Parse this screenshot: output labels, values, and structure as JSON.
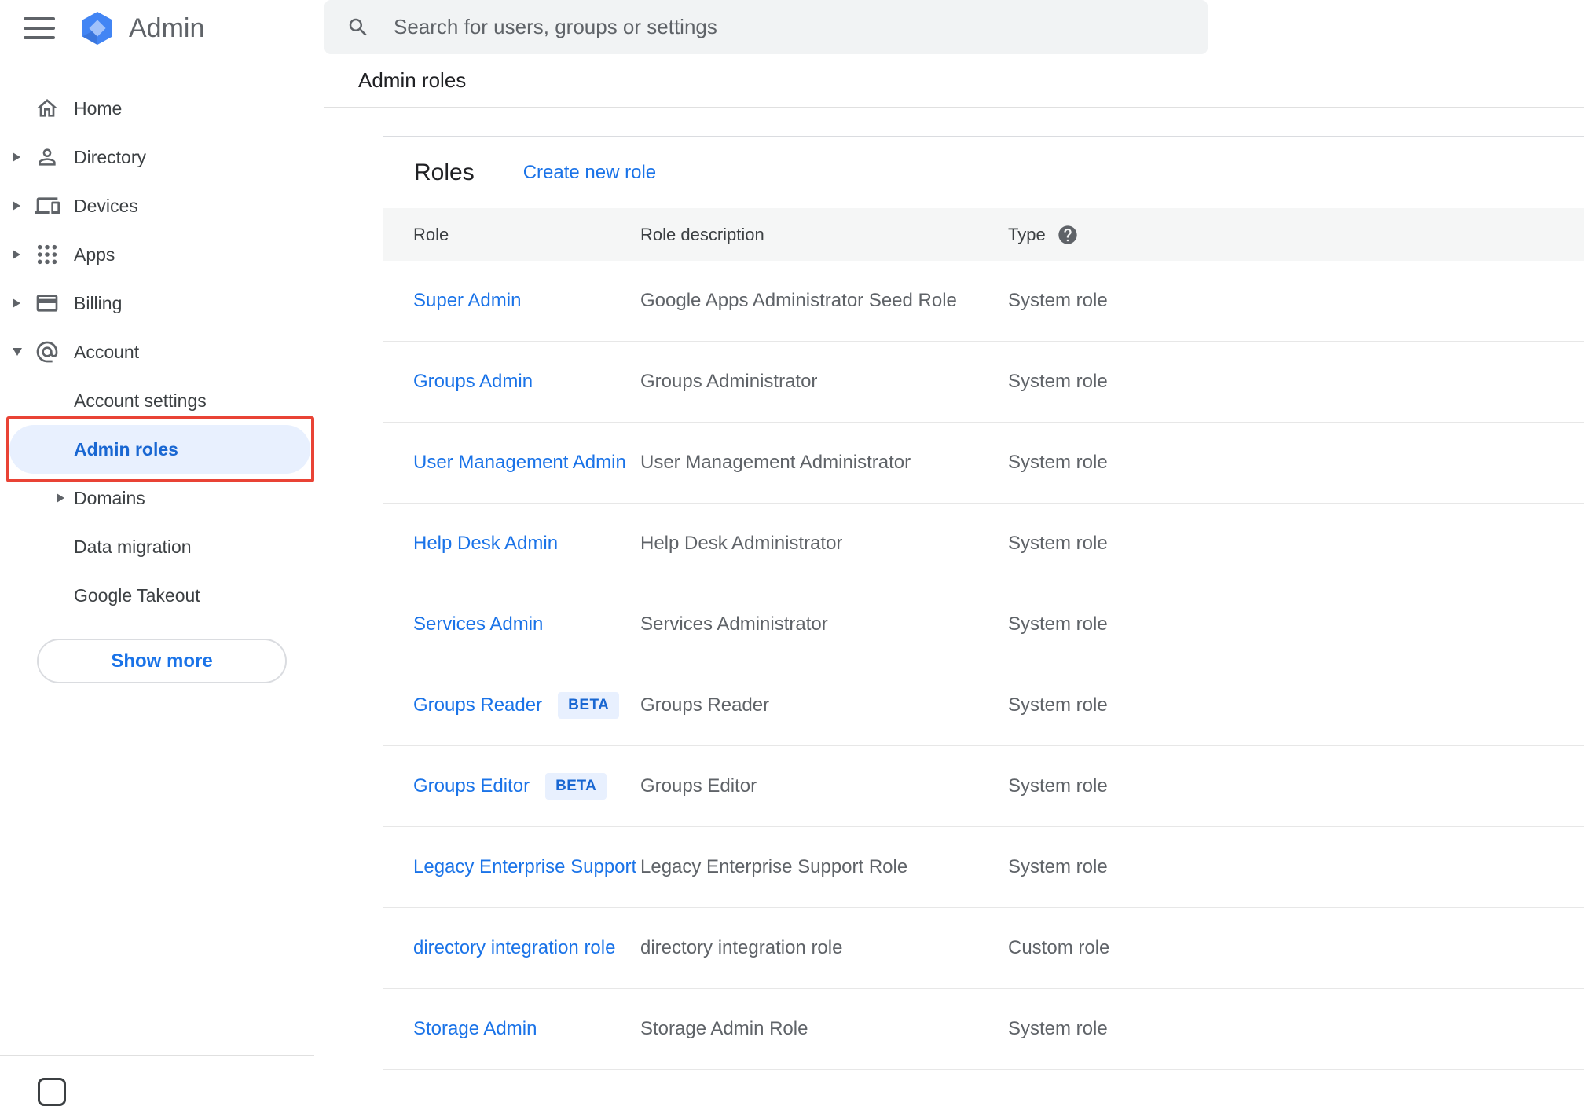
{
  "app": {
    "product_name": "Admin"
  },
  "icons": {
    "menu": "hamburger-menu-icon",
    "logo": "admin-hexagon-logo-icon",
    "search": "search-icon",
    "type_help": "help-circle-icon"
  },
  "search": {
    "placeholder": "Search for users, groups or settings"
  },
  "page": {
    "breadcrumb": "Admin roles"
  },
  "sidebar": {
    "items": [
      {
        "label": "Home",
        "icon": "home-icon",
        "expandable": false,
        "expanded": false
      },
      {
        "label": "Directory",
        "icon": "person-icon",
        "expandable": true,
        "expanded": false
      },
      {
        "label": "Devices",
        "icon": "devices-icon",
        "expandable": true,
        "expanded": false
      },
      {
        "label": "Apps",
        "icon": "apps-grid-icon",
        "expandable": true,
        "expanded": false
      },
      {
        "label": "Billing",
        "icon": "billing-card-icon",
        "expandable": true,
        "expanded": false
      },
      {
        "label": "Account",
        "icon": "at-sign-icon",
        "expandable": true,
        "expanded": true
      }
    ],
    "account_subitems": [
      {
        "label": "Account settings",
        "active": false,
        "expandable": false,
        "highlight_annotation": false
      },
      {
        "label": "Admin roles",
        "active": true,
        "expandable": false,
        "highlight_annotation": true
      },
      {
        "label": "Domains",
        "active": false,
        "expandable": true,
        "highlight_annotation": false
      },
      {
        "label": "Data migration",
        "active": false,
        "expandable": false,
        "highlight_annotation": false
      },
      {
        "label": "Google Takeout",
        "active": false,
        "expandable": false,
        "highlight_annotation": false
      }
    ],
    "show_more_label": "Show more"
  },
  "roles_panel": {
    "heading": "Roles",
    "create_link": "Create new role",
    "columns": {
      "role": "Role",
      "description": "Role description",
      "type": "Type"
    },
    "beta_badge_label": "BETA",
    "rows": [
      {
        "role": "Super Admin",
        "beta": false,
        "description": "Google Apps Administrator Seed Role",
        "type": "System role"
      },
      {
        "role": "Groups Admin",
        "beta": false,
        "description": "Groups Administrator",
        "type": "System role"
      },
      {
        "role": "User Management Admin",
        "beta": false,
        "description": "User Management Administrator",
        "type": "System role"
      },
      {
        "role": "Help Desk Admin",
        "beta": false,
        "description": "Help Desk Administrator",
        "type": "System role"
      },
      {
        "role": "Services Admin",
        "beta": false,
        "description": "Services Administrator",
        "type": "System role"
      },
      {
        "role": "Groups Reader",
        "beta": true,
        "description": "Groups Reader",
        "type": "System role"
      },
      {
        "role": "Groups Editor",
        "beta": true,
        "description": "Groups Editor",
        "type": "System role"
      },
      {
        "role": "Legacy Enterprise Support",
        "beta": false,
        "description": "Legacy Enterprise Support Role",
        "type": "System role"
      },
      {
        "role": "directory integration role",
        "beta": false,
        "description": "directory integration role",
        "type": "Custom role"
      },
      {
        "role": "Storage Admin",
        "beta": false,
        "description": "Storage Admin Role",
        "type": "System role"
      }
    ]
  },
  "colors": {
    "link_blue": "#1a73e8",
    "active_item_bg": "#e8f0fe",
    "active_item_text": "#1967d2",
    "annotation_red": "#e94335",
    "beta_bg": "#e8f0fe",
    "beta_text": "#1967d2",
    "searchbar_bg": "#f1f3f4",
    "table_header_bg": "#f5f6f6",
    "divider": "#e0e0e0",
    "text_primary": "#202124",
    "text_secondary": "#5f6368",
    "logo_blue": "#4285f4",
    "logo_inner_blue": "#a1c2fa"
  }
}
